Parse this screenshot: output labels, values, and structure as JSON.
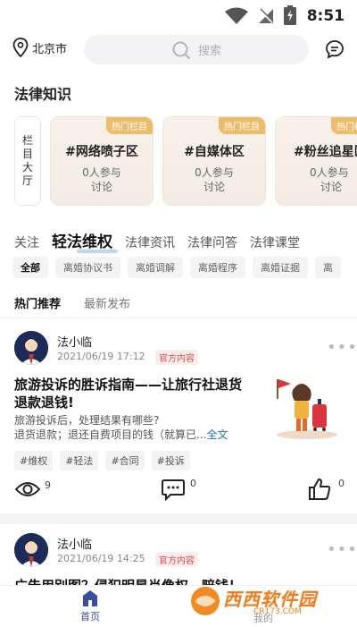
{
  "status": {
    "time": "8:51"
  },
  "topbar": {
    "city": "北京市",
    "search_placeholder": "搜索"
  },
  "section": {
    "title": "法律知识"
  },
  "side_card": {
    "lines": [
      "栏",
      "目",
      "大",
      "厅"
    ]
  },
  "cards": [
    {
      "badge": "热门栏目",
      "name": "#网络喷子区",
      "count": "0人参与",
      "sub": "讨论"
    },
    {
      "badge": "热门栏目",
      "name": "#自媒体区",
      "count": "0人参与",
      "sub": "讨论"
    },
    {
      "badge": "热门栏目",
      "name": "#粉丝追星区",
      "count": "0人参与",
      "sub": "讨论"
    }
  ],
  "tabs": [
    {
      "label": "关注",
      "active": false
    },
    {
      "label": "轻法维权",
      "active": true
    },
    {
      "label": "法律资讯",
      "active": false
    },
    {
      "label": "法律问答",
      "active": false
    },
    {
      "label": "法律课堂",
      "active": false
    }
  ],
  "chips": [
    "全部",
    "离婚协议书",
    "离婚调解",
    "离婚程序",
    "离婚证据",
    "离"
  ],
  "subtabs": [
    {
      "label": "热门推荐",
      "active": true
    },
    {
      "label": "最新发布",
      "active": false
    }
  ],
  "posts": [
    {
      "author": "法小临",
      "date": "2021/06/19 17:12",
      "official": "官方内容",
      "title": "旅游投诉的胜诉指南——让旅行社退货退款退钱!",
      "summary1": "旅游投诉后，处理结果有哪些?",
      "summary2": "退货退款；退还自费项目的钱（就算已...",
      "full_text": "全文",
      "tags": [
        "#维权",
        "#轻法",
        "#合同",
        "#投诉"
      ],
      "views": "9",
      "comments": "0",
      "likes": "0"
    },
    {
      "author": "法小临",
      "date": "2021/06/19 14:25",
      "official": "官方内容",
      "title_partial": "广告用别图？侵犯明星肖像权，赔钱！"
    }
  ],
  "bottom_nav": {
    "home": "首页",
    "mine": "我的"
  },
  "watermark": {
    "text": "西西软件园",
    "url": "CR173.COM"
  },
  "colors": {
    "badge": "#ecbd6d",
    "official": "#e04848",
    "link": "#1f6fd6",
    "tab_underline": "#b9d6f6",
    "nav_active": "#3b4d9e"
  }
}
